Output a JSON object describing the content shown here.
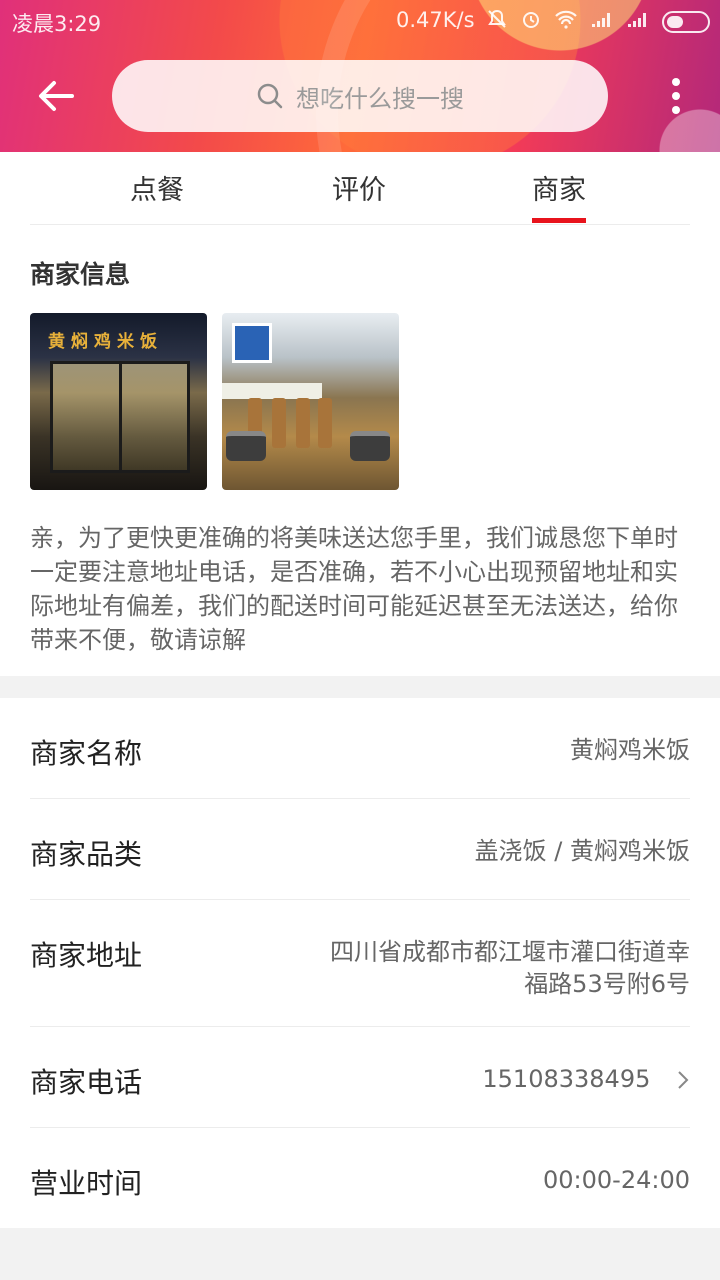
{
  "status_bar": {
    "time": "凌晨3:29",
    "speed": "0.47K/s",
    "icons": [
      "mute-bell-icon",
      "alarm-icon",
      "wifi-icon",
      "signal-icon",
      "signal-icon",
      "battery-icon"
    ]
  },
  "header": {
    "search_placeholder": "想吃什么搜一搜"
  },
  "tabs": [
    {
      "label": "点餐",
      "active": false
    },
    {
      "label": "评价",
      "active": false
    },
    {
      "label": "商家",
      "active": true
    }
  ],
  "merchant_info": {
    "title": "商家信息",
    "photo_sign_text": "黄焖鸡米饭",
    "notice": "亲，为了更快更准确的将美味送达您手里，我们诚恳您下单时一定要注意地址电话，是否准确，若不小心出现预留地址和实际地址有偏差，我们的配送时间可能延迟甚至无法送达，给你带来不便，敬请谅解"
  },
  "details": [
    {
      "label": "商家名称",
      "value": "黄焖鸡米饭"
    },
    {
      "label": "商家品类",
      "value": "盖浇饭 / 黄焖鸡米饭"
    },
    {
      "label": "商家地址",
      "value_line1": "四川省成都市都江堰市灌口街道幸",
      "value_line2": "福路53号附6号"
    },
    {
      "label": "商家电话",
      "value": "15108338495"
    },
    {
      "label": "营业时间",
      "value": "00:00-24:00"
    }
  ],
  "colors": {
    "accent": "#e8131c",
    "text_primary": "#222222",
    "text_secondary": "#666666",
    "background": "#f2f2f2"
  }
}
